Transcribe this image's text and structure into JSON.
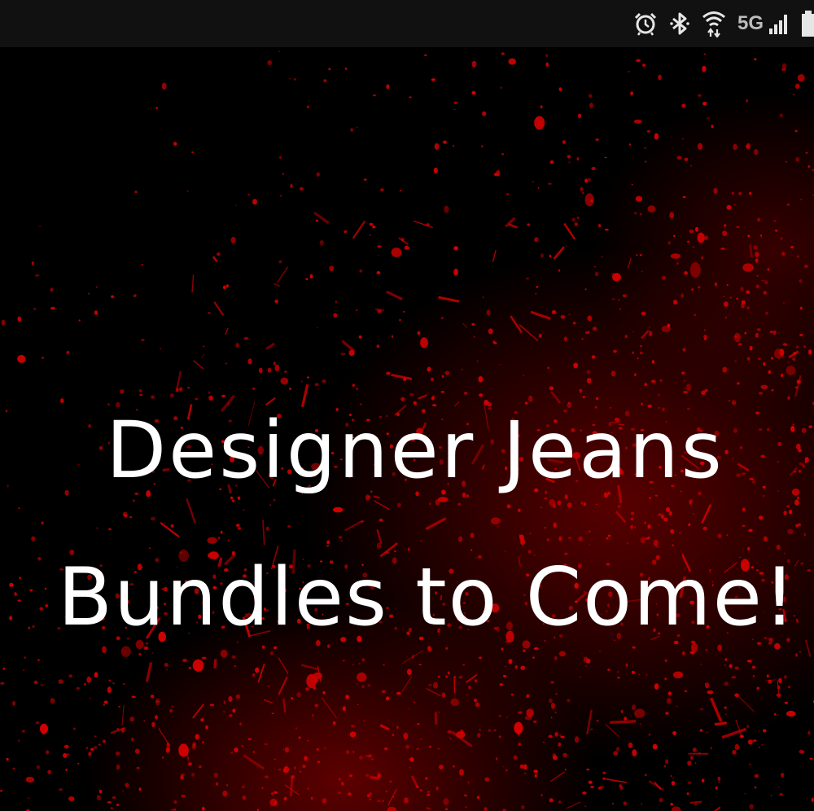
{
  "status_bar": {
    "network_label": "5G",
    "icons": [
      "alarm-icon",
      "bluetooth-icon",
      "wifi-icon",
      "signal-icon",
      "battery-icon"
    ]
  },
  "image": {
    "line1": "Designer Jeans",
    "line2": "Bundles to Come!"
  },
  "colors": {
    "status_bar_bg": "#111111",
    "status_icon": "#e6e6e6",
    "splatter_red": "#d40000",
    "text": "#ffffff",
    "background": "#000000"
  }
}
